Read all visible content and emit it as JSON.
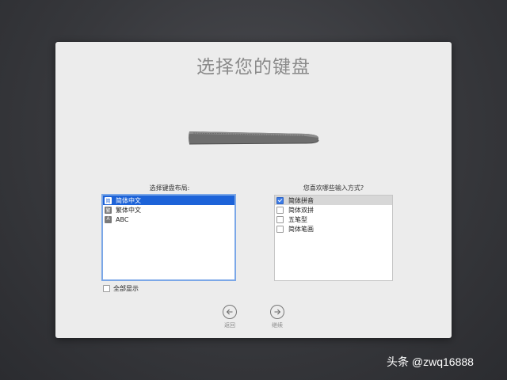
{
  "title": "选择您的键盘",
  "layout_label": "选择键盘布局:",
  "layout_items": [
    {
      "label": "简体中文",
      "icon": "简"
    },
    {
      "label": "繁体中文",
      "icon": "繁"
    },
    {
      "label": "ABC",
      "icon": "A"
    }
  ],
  "input_label": "您喜欢哪些输入方式?",
  "input_items": [
    {
      "label": "简体拼音",
      "checked": true
    },
    {
      "label": "简体双拼",
      "checked": false
    },
    {
      "label": "五笔型",
      "checked": false
    },
    {
      "label": "简体笔画",
      "checked": false
    }
  ],
  "show_all_label": "全部显示",
  "back_label": "返回",
  "continue_label": "继续",
  "watermark": "头条 @zwq16888",
  "icons": {
    "back": "arrow-left-circle-icon",
    "continue": "arrow-right-circle-icon",
    "keyboard": "keyboard-illustration"
  },
  "colors": {
    "selection_blue": "#1d63d8",
    "title_gray": "#8a8a8a"
  }
}
